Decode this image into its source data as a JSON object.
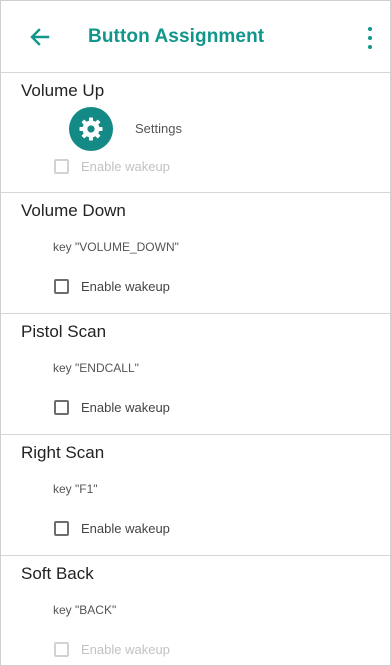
{
  "header": {
    "title": "Button Assignment",
    "back_icon": "arrow-left-icon",
    "menu_icon": "more-vert-icon",
    "accent_color": "#11968b"
  },
  "sections": [
    {
      "title": "Volume Up",
      "app_label": "Settings",
      "app_icon": "gear-icon",
      "checkbox_label": "Enable wakeup",
      "checkbox_enabled": false
    },
    {
      "title": "Volume Down",
      "key": "key \"VOLUME_DOWN\"",
      "checkbox_label": "Enable wakeup",
      "checkbox_enabled": true
    },
    {
      "title": "Pistol Scan",
      "key": "key \"ENDCALL\"",
      "checkbox_label": "Enable wakeup",
      "checkbox_enabled": true
    },
    {
      "title": "Right Scan",
      "key": "key \"F1\"",
      "checkbox_label": "Enable wakeup",
      "checkbox_enabled": true
    },
    {
      "title": "Soft Back",
      "key": "key \"BACK\"",
      "checkbox_label": "Enable wakeup",
      "checkbox_enabled": false
    }
  ]
}
